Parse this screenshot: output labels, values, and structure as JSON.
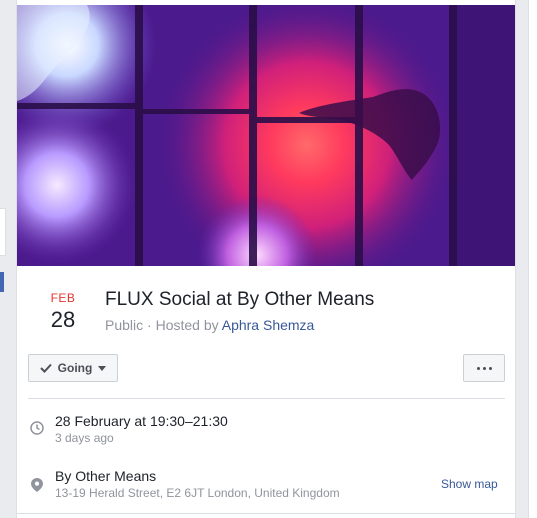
{
  "event": {
    "date_month": "FEB",
    "date_day": "28",
    "title": "FLUX Social at By Other Means",
    "visibility": "Public",
    "hosted_by_prefix": " · Hosted by ",
    "host_name": "Aphra Shemza",
    "colors": {
      "month": "#e4352d",
      "link": "#385898"
    }
  },
  "actions": {
    "going_label": "Going",
    "going_icon": "check-icon",
    "going_caret_icon": "caret-down-icon",
    "more_icon": "more-dots-icon"
  },
  "details": {
    "time_icon": "clock-icon",
    "time_main": "28 February at 19:30–21:30",
    "time_sub": "3 days ago",
    "place_icon": "map-pin-icon",
    "place_main": "By Other Means",
    "place_sub": "13-19 Herald Street, E2 6JT London, United Kingdom",
    "show_map_label": "Show map"
  }
}
